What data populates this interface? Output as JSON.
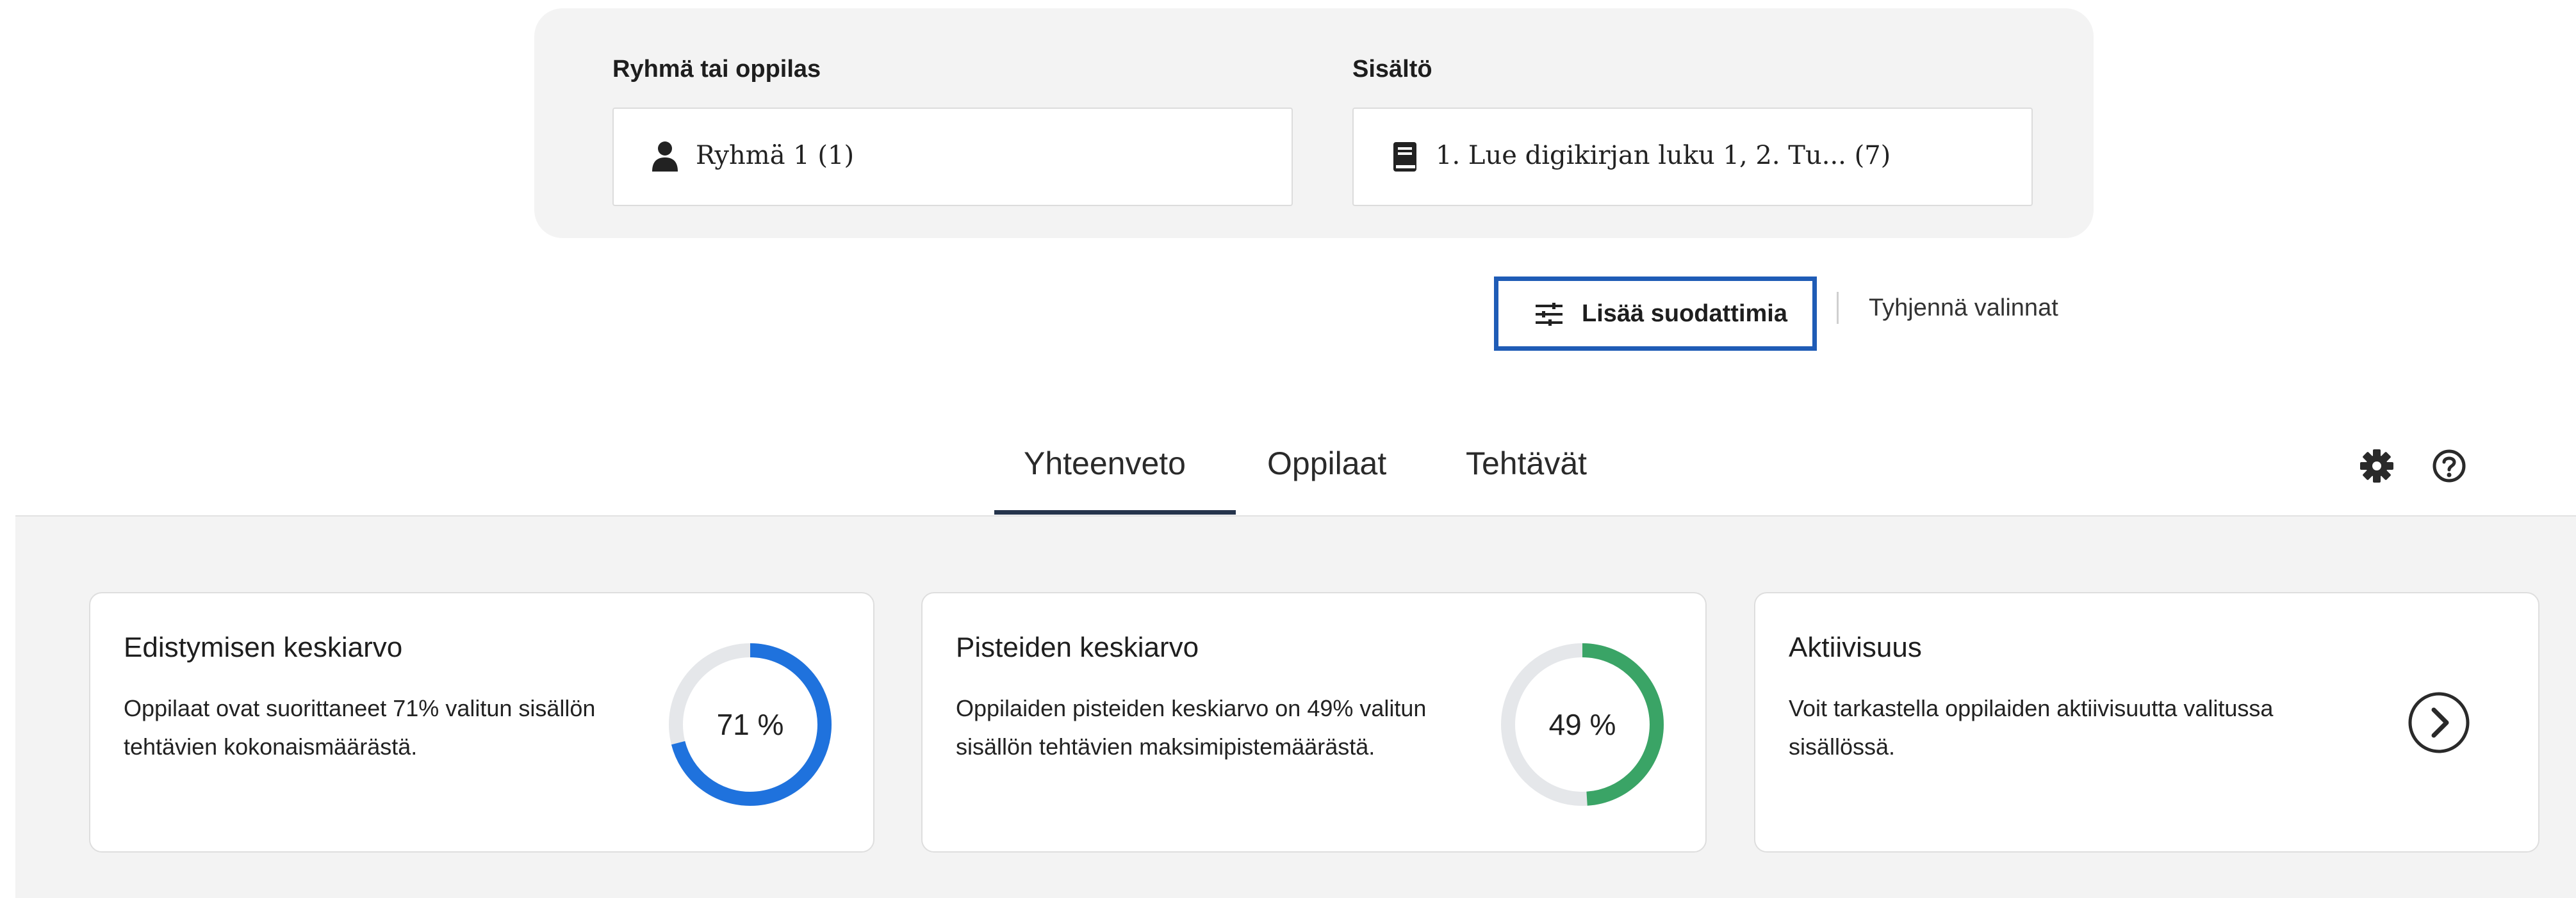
{
  "filters": {
    "group_label": "Ryhmä tai oppilas",
    "group_value": "Ryhmä 1 (1)",
    "content_label": "Sisältö",
    "content_value": "1. Lue digikirjan luku 1, 2. Tu... (7)",
    "more_filters_label": "Lisää suodattimia",
    "clear_label": "Tyhjennä valinnat"
  },
  "icons": {
    "group": "person-icon",
    "content": "book-icon",
    "more_filters": "sliders-icon",
    "settings": "gear-icon",
    "help": "help-icon",
    "arrow": "chevron-right-icon"
  },
  "tabs": [
    {
      "label": "Yhteenveto",
      "active": true
    },
    {
      "label": "Oppilaat",
      "active": false
    },
    {
      "label": "Tehtävät",
      "active": false
    }
  ],
  "cards": [
    {
      "title": "Edistymisen keskiarvo",
      "text": "Oppilaat ovat suorittaneet 71% valitun sisällön tehtävien kokonaismäärästä.",
      "value": 71,
      "value_label": "71 %",
      "color": "#1f72dd"
    },
    {
      "title": "Pisteiden keskiarvo",
      "text": "Oppilaiden pisteiden keskiarvo on 49% valitun sisällön tehtävien maksimipistemäärästä.",
      "value": 49,
      "value_label": "49 %",
      "color": "#3aa466"
    },
    {
      "title": "Aktiivisuus",
      "text": "Voit tarkastella oppilaiden aktiivisuutta valitussa sisällössä."
    }
  ],
  "colors": {
    "accent_border": "#1f5cb6",
    "tab_underline": "#25344c",
    "ring_track": "#e5e7ea"
  }
}
